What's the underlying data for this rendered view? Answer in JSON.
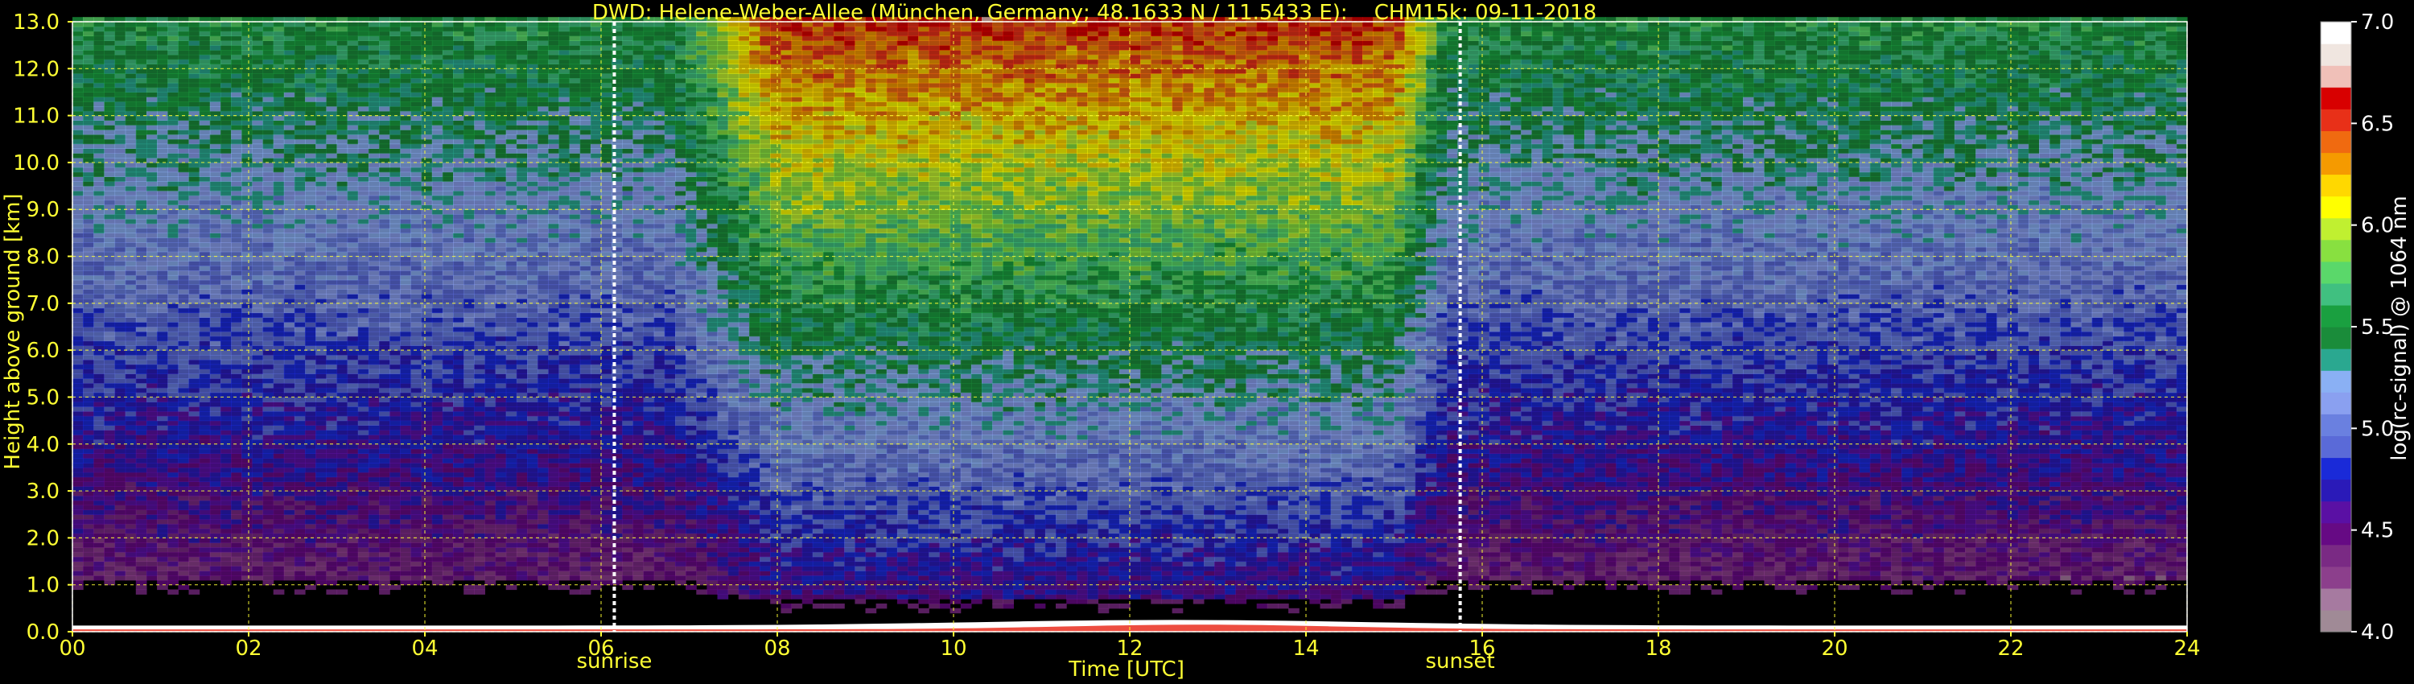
{
  "chart_data": {
    "type": "heatmap",
    "title": "DWD: Helene-Weber-Allee (München, Germany; 48.1633 N / 11.5433 E):    CHM15k: 09-11-2018",
    "xlabel": "Time [UTC]",
    "ylabel": "Height above ground [km]",
    "xlim": [
      0,
      24
    ],
    "ylim": [
      0,
      13
    ],
    "x_ticks": [
      0,
      2,
      4,
      6,
      8,
      10,
      12,
      14,
      16,
      18,
      20,
      22,
      24
    ],
    "x_tick_labels": [
      "00",
      "02",
      "04",
      "06",
      "08",
      "10",
      "12",
      "14",
      "16",
      "18",
      "20",
      "22",
      "24"
    ],
    "y_ticks": [
      0,
      1,
      2,
      3,
      4,
      5,
      6,
      7,
      8,
      9,
      10,
      11,
      12,
      13
    ],
    "y_tick_labels": [
      "0.0",
      "1.0",
      "2.0",
      "3.0",
      "4.0",
      "5.0",
      "6.0",
      "7.0",
      "8.0",
      "9.0",
      "10.0",
      "11.0",
      "12.0",
      "13.0"
    ],
    "grid": true,
    "annotations": [
      {
        "label": "sunrise",
        "x": 6.15
      },
      {
        "label": "sunset",
        "x": 15.75
      }
    ],
    "colorbar": {
      "label": "log(rc-signal) @ 1064 nm",
      "range": [
        4.0,
        7.0
      ],
      "ticks": [
        4.0,
        4.5,
        5.0,
        5.5,
        6.0,
        6.5,
        7.0
      ],
      "tick_labels": [
        "4.0",
        "4.5",
        "5.0",
        "5.5",
        "6.0",
        "6.5",
        "7.0"
      ],
      "colors": [
        "#a08a96",
        "#a67aa0",
        "#8c3f8c",
        "#7a2a84",
        "#660a84",
        "#5a10a4",
        "#2a1ab8",
        "#1a2ad8",
        "#5a6ad8",
        "#6a80e0",
        "#8aa0f0",
        "#8ab0f4",
        "#2aa890",
        "#1a8c3a",
        "#1aa040",
        "#40c080",
        "#5ad86a",
        "#88e040",
        "#c0f030",
        "#ffff00",
        "#ffd800",
        "#f59a00",
        "#f06a10",
        "#e83018",
        "#d80000",
        "#f0c0b8",
        "#f0e6e0",
        "#ffffff"
      ]
    }
  }
}
